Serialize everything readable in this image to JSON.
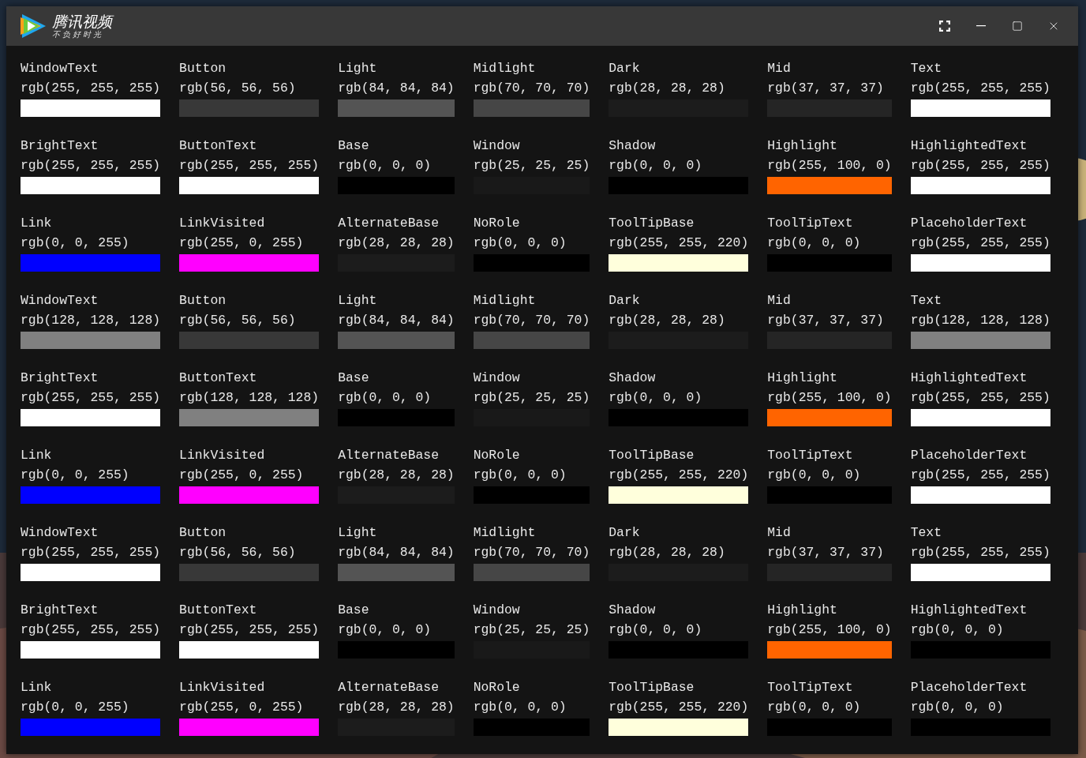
{
  "window": {
    "logo": {
      "name": "腾讯视频",
      "slogan": "不负好时光"
    }
  },
  "rows": [
    {
      "cells": [
        {
          "role": "WindowText",
          "value": "rgb(255, 255, 255)",
          "color": "#ffffff"
        },
        {
          "role": "Button",
          "value": "rgb(56, 56, 56)",
          "color": "#383838"
        },
        {
          "role": "Light",
          "value": "rgb(84, 84, 84)",
          "color": "#545454"
        },
        {
          "role": "Midlight",
          "value": "rgb(70, 70, 70)",
          "color": "#464646"
        },
        {
          "role": "Dark",
          "value": "rgb(28, 28, 28)",
          "color": "#1c1c1c"
        },
        {
          "role": "Mid",
          "value": "rgb(37, 37, 37)",
          "color": "#252525"
        },
        {
          "role": "Text",
          "value": "rgb(255, 255, 255)",
          "color": "#ffffff"
        }
      ]
    },
    {
      "cells": [
        {
          "role": "BrightText",
          "value": "rgb(255, 255, 255)",
          "color": "#ffffff"
        },
        {
          "role": "ButtonText",
          "value": "rgb(255, 255, 255)",
          "color": "#ffffff"
        },
        {
          "role": "Base",
          "value": "rgb(0, 0, 0)",
          "color": "#000000"
        },
        {
          "role": "Window",
          "value": "rgb(25, 25, 25)",
          "color": "#191919"
        },
        {
          "role": "Shadow",
          "value": "rgb(0, 0, 0)",
          "color": "#000000"
        },
        {
          "role": "Highlight",
          "value": "rgb(255, 100, 0)",
          "color": "#ff6400"
        },
        {
          "role": "HighlightedText",
          "value": "rgb(255, 255, 255)",
          "color": "#ffffff"
        }
      ]
    },
    {
      "cells": [
        {
          "role": "Link",
          "value": "rgb(0, 0, 255)",
          "color": "#0000ff"
        },
        {
          "role": "LinkVisited",
          "value": "rgb(255, 0, 255)",
          "color": "#ff00ff"
        },
        {
          "role": "AlternateBase",
          "value": "rgb(28, 28, 28)",
          "color": "#1c1c1c"
        },
        {
          "role": "NoRole",
          "value": "rgb(0, 0, 0)",
          "color": "#000000"
        },
        {
          "role": "ToolTipBase",
          "value": "rgb(255, 255, 220)",
          "color": "#ffffdc"
        },
        {
          "role": "ToolTipText",
          "value": "rgb(0, 0, 0)",
          "color": "#000000"
        },
        {
          "role": "PlaceholderText",
          "value": "rgb(255, 255, 255)",
          "color": "#ffffff"
        }
      ]
    },
    {
      "cells": [
        {
          "role": "WindowText",
          "value": "rgb(128, 128, 128)",
          "color": "#808080"
        },
        {
          "role": "Button",
          "value": "rgb(56, 56, 56)",
          "color": "#383838"
        },
        {
          "role": "Light",
          "value": "rgb(84, 84, 84)",
          "color": "#545454"
        },
        {
          "role": "Midlight",
          "value": "rgb(70, 70, 70)",
          "color": "#464646"
        },
        {
          "role": "Dark",
          "value": "rgb(28, 28, 28)",
          "color": "#1c1c1c"
        },
        {
          "role": "Mid",
          "value": "rgb(37, 37, 37)",
          "color": "#252525"
        },
        {
          "role": "Text",
          "value": "rgb(128, 128, 128)",
          "color": "#808080"
        }
      ]
    },
    {
      "cells": [
        {
          "role": "BrightText",
          "value": "rgb(255, 255, 255)",
          "color": "#ffffff"
        },
        {
          "role": "ButtonText",
          "value": "rgb(128, 128, 128)",
          "color": "#808080"
        },
        {
          "role": "Base",
          "value": "rgb(0, 0, 0)",
          "color": "#000000"
        },
        {
          "role": "Window",
          "value": "rgb(25, 25, 25)",
          "color": "#191919"
        },
        {
          "role": "Shadow",
          "value": "rgb(0, 0, 0)",
          "color": "#000000"
        },
        {
          "role": "Highlight",
          "value": "rgb(255, 100, 0)",
          "color": "#ff6400"
        },
        {
          "role": "HighlightedText",
          "value": "rgb(255, 255, 255)",
          "color": "#ffffff"
        }
      ]
    },
    {
      "cells": [
        {
          "role": "Link",
          "value": "rgb(0, 0, 255)",
          "color": "#0000ff"
        },
        {
          "role": "LinkVisited",
          "value": "rgb(255, 0, 255)",
          "color": "#ff00ff"
        },
        {
          "role": "AlternateBase",
          "value": "rgb(28, 28, 28)",
          "color": "#1c1c1c"
        },
        {
          "role": "NoRole",
          "value": "rgb(0, 0, 0)",
          "color": "#000000"
        },
        {
          "role": "ToolTipBase",
          "value": "rgb(255, 255, 220)",
          "color": "#ffffdc"
        },
        {
          "role": "ToolTipText",
          "value": "rgb(0, 0, 0)",
          "color": "#000000"
        },
        {
          "role": "PlaceholderText",
          "value": "rgb(255, 255, 255)",
          "color": "#ffffff"
        }
      ]
    },
    {
      "cells": [
        {
          "role": "WindowText",
          "value": "rgb(255, 255, 255)",
          "color": "#ffffff"
        },
        {
          "role": "Button",
          "value": "rgb(56, 56, 56)",
          "color": "#383838"
        },
        {
          "role": "Light",
          "value": "rgb(84, 84, 84)",
          "color": "#545454"
        },
        {
          "role": "Midlight",
          "value": "rgb(70, 70, 70)",
          "color": "#464646"
        },
        {
          "role": "Dark",
          "value": "rgb(28, 28, 28)",
          "color": "#1c1c1c"
        },
        {
          "role": "Mid",
          "value": "rgb(37, 37, 37)",
          "color": "#252525"
        },
        {
          "role": "Text",
          "value": "rgb(255, 255, 255)",
          "color": "#ffffff"
        }
      ]
    },
    {
      "cells": [
        {
          "role": "BrightText",
          "value": "rgb(255, 255, 255)",
          "color": "#ffffff"
        },
        {
          "role": "ButtonText",
          "value": "rgb(255, 255, 255)",
          "color": "#ffffff"
        },
        {
          "role": "Base",
          "value": "rgb(0, 0, 0)",
          "color": "#000000"
        },
        {
          "role": "Window",
          "value": "rgb(25, 25, 25)",
          "color": "#191919"
        },
        {
          "role": "Shadow",
          "value": "rgb(0, 0, 0)",
          "color": "#000000"
        },
        {
          "role": "Highlight",
          "value": "rgb(255, 100, 0)",
          "color": "#ff6400"
        },
        {
          "role": "HighlightedText",
          "value": "rgb(0, 0, 0)",
          "color": "#000000"
        }
      ]
    },
    {
      "cells": [
        {
          "role": "Link",
          "value": "rgb(0, 0, 255)",
          "color": "#0000ff"
        },
        {
          "role": "LinkVisited",
          "value": "rgb(255, 0, 255)",
          "color": "#ff00ff"
        },
        {
          "role": "AlternateBase",
          "value": "rgb(28, 28, 28)",
          "color": "#1c1c1c"
        },
        {
          "role": "NoRole",
          "value": "rgb(0, 0, 0)",
          "color": "#000000"
        },
        {
          "role": "ToolTipBase",
          "value": "rgb(255, 255, 220)",
          "color": "#ffffdc"
        },
        {
          "role": "ToolTipText",
          "value": "rgb(0, 0, 0)",
          "color": "#000000"
        },
        {
          "role": "PlaceholderText",
          "value": "rgb(0, 0, 0)",
          "color": "#000000"
        }
      ]
    }
  ]
}
